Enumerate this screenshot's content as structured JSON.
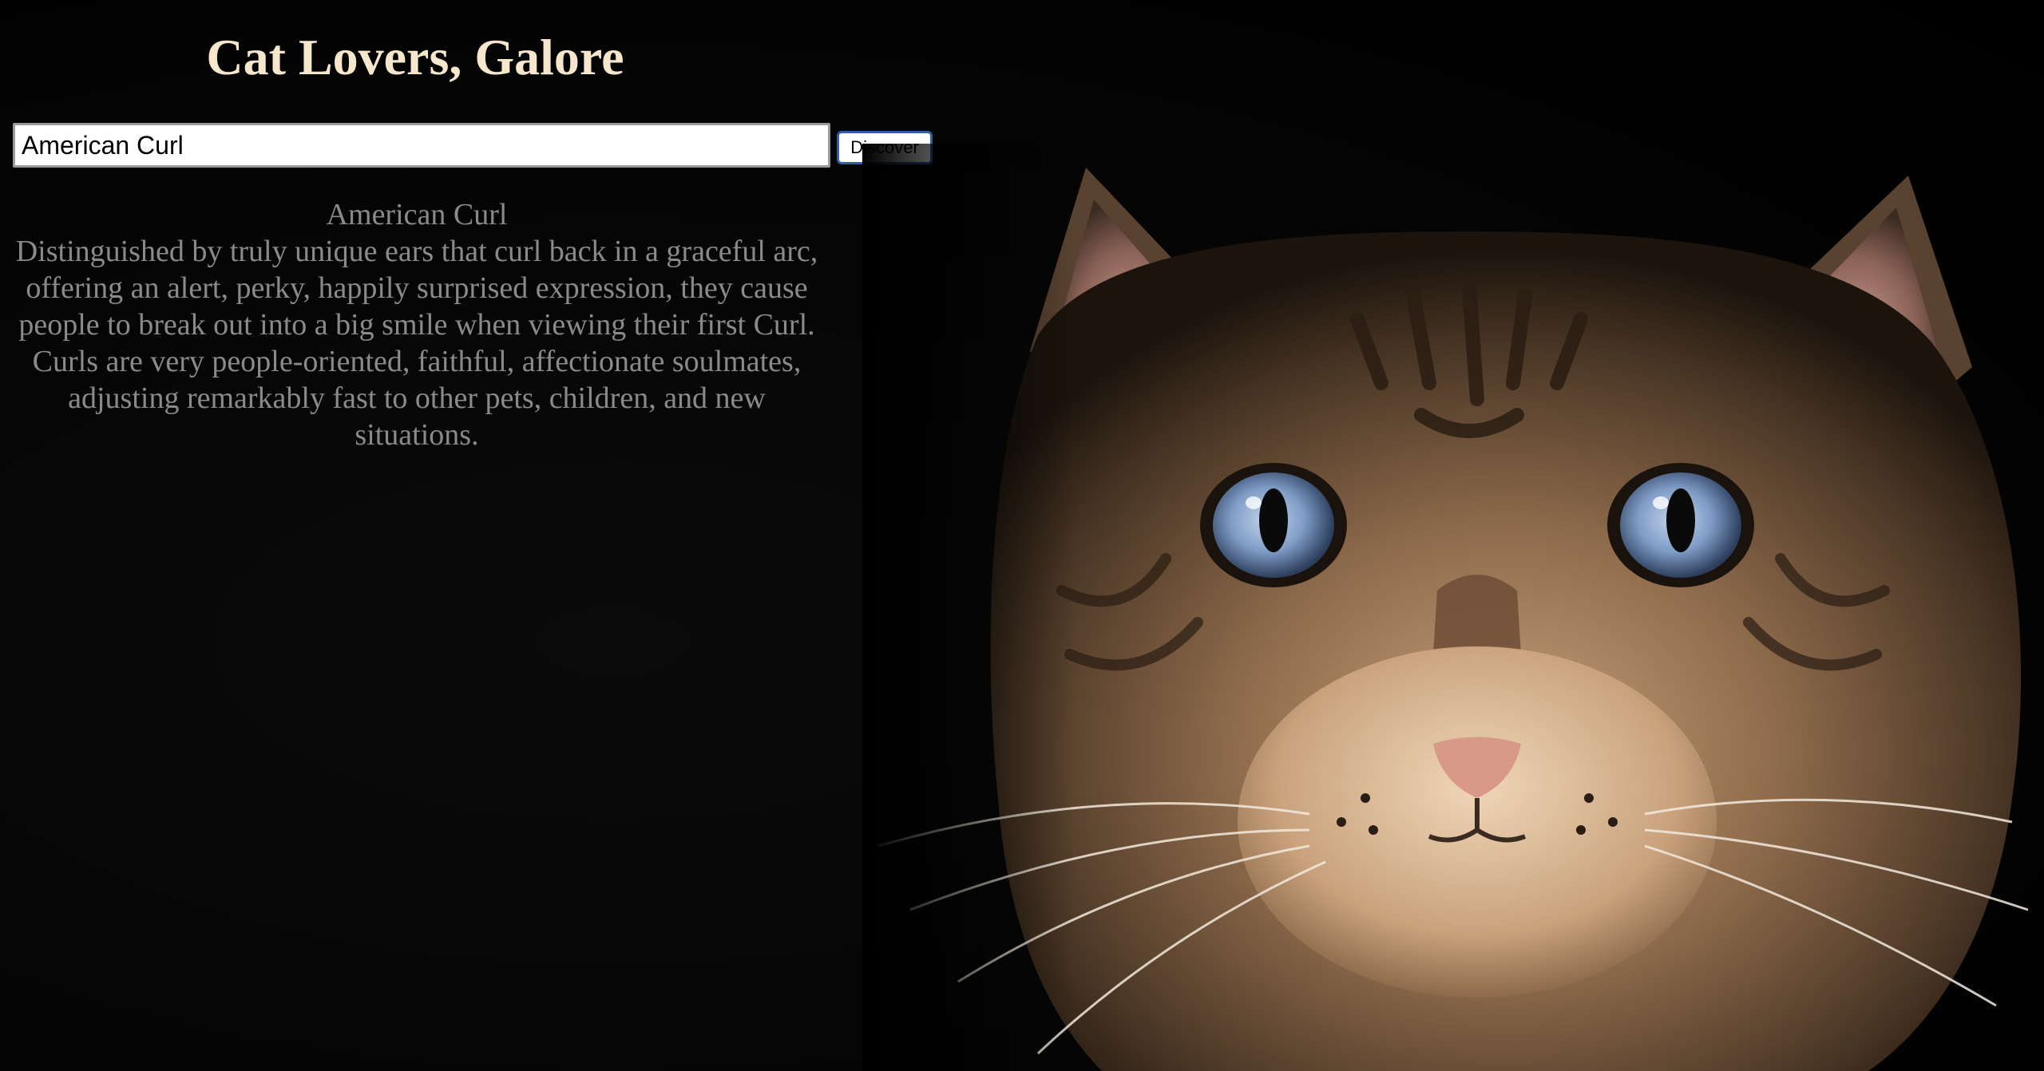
{
  "header": {
    "title": "Cat Lovers, Galore"
  },
  "search": {
    "value": "American Curl",
    "button_label": "Discover"
  },
  "result": {
    "breed_name": "American Curl",
    "description": "Distinguished by truly unique ears that curl back in a graceful arc, offering an alert, perky, happily surprised expression, they cause people to break out into a big smile when viewing their first Curl. Curls are very people-oriented, faithful, affectionate soulmates, adjusting remarkably fast to other pets, children, and new situations."
  },
  "image": {
    "subject": "tabby cat with blue eyes",
    "colors": {
      "background": "#000000",
      "title": "#f5e6cc",
      "description_text": "#8a8a8a",
      "button_border": "#2f5fa7"
    }
  }
}
